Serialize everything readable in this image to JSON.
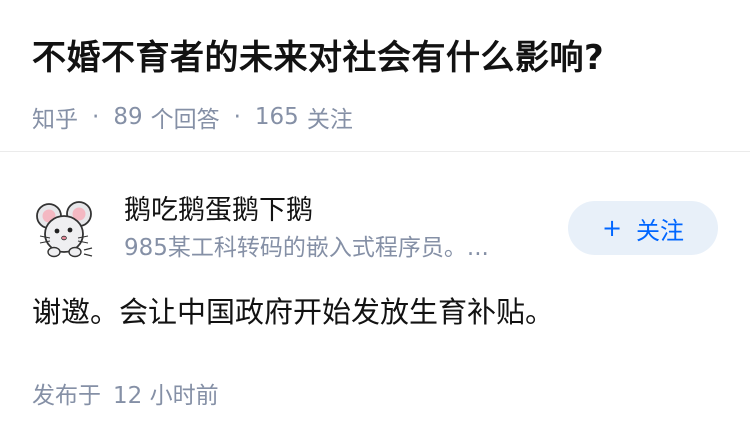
{
  "question": {
    "title": "不婚不育者的未来对社会有什么影响?",
    "source": "知乎",
    "separator": "·",
    "answers_count": "89",
    "answers_label": "个回答",
    "followers_count": "165",
    "followers_label": "关注"
  },
  "answer": {
    "author": {
      "name": "鹅吃鹅蛋鹅下鹅",
      "headline": "985某工科转码的嵌入式程序员。..."
    },
    "follow_button": {
      "icon": "plus-icon",
      "plus": "+",
      "label": "关注"
    },
    "content": "谢邀。会让中国政府开始发放生育补贴。",
    "published_label": "发布于",
    "published_time": "12 小时前"
  },
  "colors": {
    "accent": "#0066ff",
    "follow_button_bg": "#e8f0f9",
    "meta_gray": "#8590a6",
    "text": "#121212"
  }
}
